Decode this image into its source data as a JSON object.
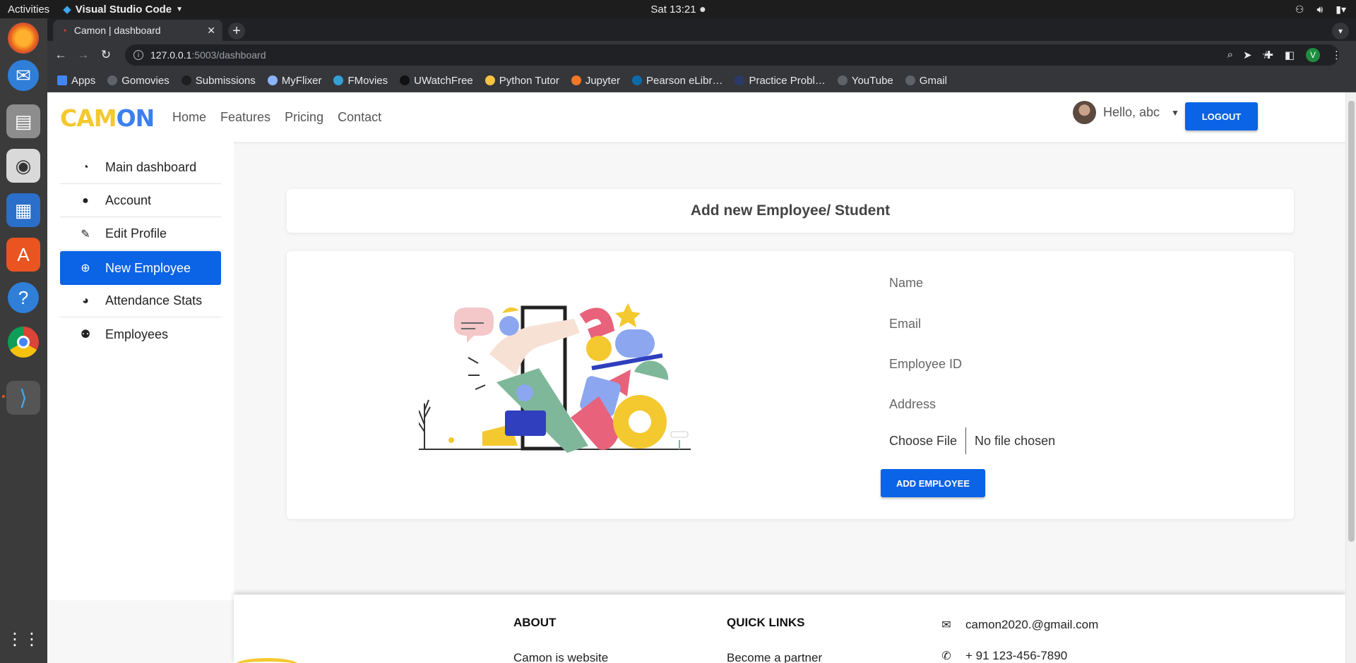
{
  "system": {
    "activities": "Activities",
    "app_name": "Visual Studio Code",
    "clock": "Sat 13:21"
  },
  "browser": {
    "tab_title": "Camon | dashboard",
    "url_host": "127.0.0.1",
    "url_path": ":5003/dashboard",
    "profile_initial": "V",
    "bookmarks": [
      {
        "label": "Apps",
        "color": "#4285f4"
      },
      {
        "label": "Gomovies",
        "color": "#5f6368"
      },
      {
        "label": "Submissions",
        "color": "#1e1e1e"
      },
      {
        "label": "MyFlixer",
        "color": "#8ab4f8"
      },
      {
        "label": "FMovies",
        "color": "#34a0d4"
      },
      {
        "label": "UWatchFree",
        "color": "#111111"
      },
      {
        "label": "Python Tutor",
        "color": "#f6c343"
      },
      {
        "label": "Jupyter",
        "color": "#f37726"
      },
      {
        "label": "Pearson eLibr…",
        "color": "#0d6aa8"
      },
      {
        "label": "Practice Probl…",
        "color": "#2b3a67"
      },
      {
        "label": "YouTube",
        "color": "#5f6368"
      },
      {
        "label": "Gmail",
        "color": "#5f6368"
      }
    ]
  },
  "navbar": {
    "logo_part1": "CAM",
    "logo_part2": "ON",
    "links": [
      "Home",
      "Features",
      "Pricing",
      "Contact"
    ],
    "greeting": "Hello, abc",
    "logout_label": "LOGOUT"
  },
  "sidebar": {
    "items": [
      {
        "label": "Main dashboard",
        "icon": "tachometer-icon"
      },
      {
        "label": "Account",
        "icon": "user-icon"
      },
      {
        "label": "Edit Profile",
        "icon": "user-edit-icon"
      },
      {
        "label": "New Employee",
        "icon": "plus-circle-icon",
        "active": true
      },
      {
        "label": "Attendance Stats",
        "icon": "pie-chart-icon"
      },
      {
        "label": "Employees",
        "icon": "users-icon"
      }
    ]
  },
  "main": {
    "title": "Add new Employee/ Student",
    "form": {
      "name_placeholder": "Name",
      "email_placeholder": "Email",
      "employee_id_placeholder": "Employee ID",
      "address_placeholder": "Address",
      "file_button": "Choose File",
      "file_status": "No file chosen",
      "submit_label": "ADD EMPLOYEE"
    }
  },
  "footer": {
    "about_heading": "ABOUT",
    "about_text": "Camon is website",
    "quick_links_heading": "QUICK LINKS",
    "quick_link_1": "Become a partner",
    "email": "camon2020.@gmail.com",
    "phone": "+ 91 123-456-7890"
  },
  "colors": {
    "primary": "#0b63e5",
    "logo_yellow": "#f4c82f",
    "logo_blue": "#3c80f0"
  }
}
